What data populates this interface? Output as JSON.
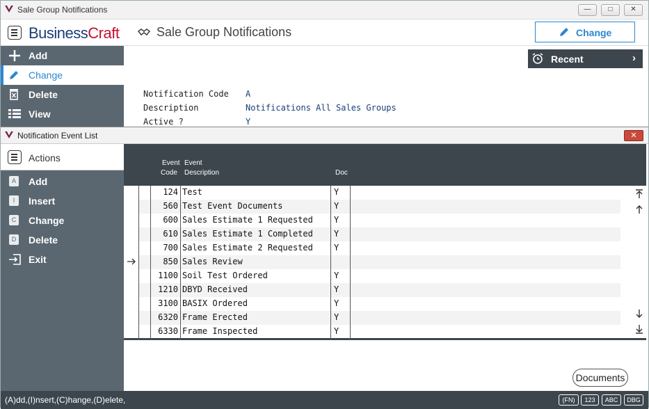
{
  "window": {
    "title": "Sale Group Notifications"
  },
  "header": {
    "brand_prefix": "Business",
    "brand_suffix": "Craft",
    "page_title": "Sale Group Notifications",
    "change_label": "Change"
  },
  "sidebar": {
    "items": [
      {
        "label": "Add",
        "icon": "plus-icon"
      },
      {
        "label": "Change",
        "icon": "pencil-icon"
      },
      {
        "label": "Delete",
        "icon": "trash-icon"
      },
      {
        "label": "View",
        "icon": "list-icon"
      }
    ]
  },
  "recent": {
    "label": "Recent"
  },
  "fields": [
    {
      "label": "Notification Code",
      "value": "A"
    },
    {
      "label": "Description",
      "value": "Notifications All Sales Groups"
    },
    {
      "label": "Active ?",
      "value": "Y"
    }
  ],
  "inner": {
    "title": "Notification Event List"
  },
  "actions": {
    "header": "Actions",
    "items": [
      {
        "key": "A",
        "label": "Add"
      },
      {
        "key": "I",
        "label": "Insert"
      },
      {
        "key": "C",
        "label": "Change"
      },
      {
        "key": "D",
        "label": "Delete"
      },
      {
        "key": "",
        "label": "Exit"
      }
    ]
  },
  "grid": {
    "headers": {
      "code_1": "Event",
      "code_2": "Code",
      "desc_1": "Event",
      "desc_2": "Description",
      "doc": "Doc"
    },
    "rows": [
      {
        "code": "124",
        "desc": "Test",
        "doc": "Y"
      },
      {
        "code": "560",
        "desc": "Test Event Documents",
        "doc": "Y"
      },
      {
        "code": "600",
        "desc": "Sales Estimate 1 Requested",
        "doc": "Y"
      },
      {
        "code": "610",
        "desc": "Sales Estimate 1 Completed",
        "doc": "Y"
      },
      {
        "code": "700",
        "desc": "Sales Estimate 2 Requested",
        "doc": "Y"
      },
      {
        "code": "850",
        "desc": "Sales Review",
        "doc": ""
      },
      {
        "code": "1100",
        "desc": "Soil Test Ordered",
        "doc": "Y"
      },
      {
        "code": "1210",
        "desc": "DBYD Received",
        "doc": "Y"
      },
      {
        "code": "3100",
        "desc": "BASIX Ordered",
        "doc": "Y"
      },
      {
        "code": "6320",
        "desc": "Frame Erected",
        "doc": "Y"
      },
      {
        "code": "6330",
        "desc": "Frame Inspected",
        "doc": "Y"
      }
    ],
    "current_row_index": 5
  },
  "documents_label": "Documents",
  "status": {
    "hint": "(A)dd,(I)nsert,(C)hange,(D)elete,",
    "badges": [
      "(FN)",
      "123",
      "ABC",
      "DBG"
    ]
  }
}
